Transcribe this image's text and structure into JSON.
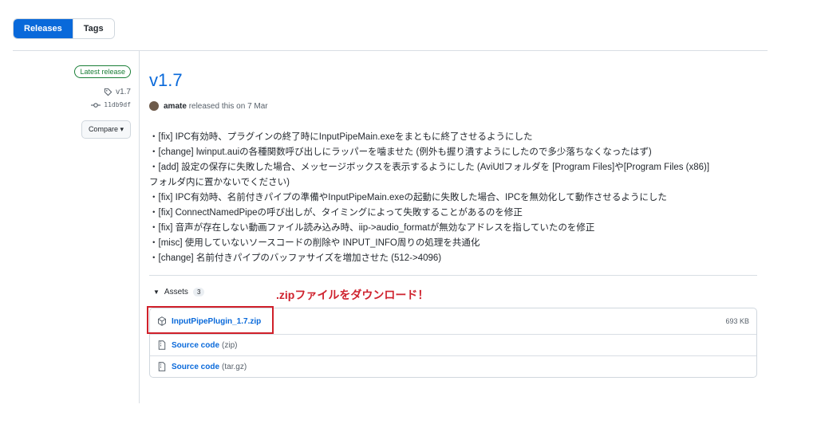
{
  "tabs": {
    "releases": "Releases",
    "tags": "Tags"
  },
  "sidebar": {
    "badge": "Latest release",
    "tag": "v1.7",
    "commit": "11db9df",
    "compare": "Compare"
  },
  "release": {
    "title": "v1.7",
    "author": "amate",
    "released_text": "released this on 7 Mar",
    "notes": [
      "・[fix] IPC有効時、プラグインの終了時にInputPipeMain.exeをまともに終了させるようにした",
      "・[change] lwinput.auiの各種関数呼び出しにラッパーを噛ませた (例外も握り潰すようにしたので多少落ちなくなったはず)",
      "・[add] 設定の保存に失敗した場合、メッセージボックスを表示するようにした (AviUtlフォルダを [Program Files]や[Program Files (x86)]",
      "フォルダ内に置かないでください)",
      "・[fix] IPC有効時、名前付きパイプの準備やInputPipeMain.exeの起動に失敗した場合、IPCを無効化して動作させるようにした",
      "・[fix] ConnectNamedPipeの呼び出しが、タイミングによって失敗することがあるのを修正",
      "・[fix] 音声が存在しない動画ファイル読み込み時、iip->audio_formatが無効なアドレスを指していたのを修正",
      "・[misc] 使用していないソースコードの削除や INPUT_INFO周りの処理を共通化",
      "・[change] 名前付きパイプのバッファサイズを増加させた (512->4096)"
    ]
  },
  "assets": {
    "label": "Assets",
    "count": "3",
    "annotation": ".zipファイルをダウンロード！",
    "items": [
      {
        "name": "InputPipePlugin_1.7.zip",
        "suffix": "",
        "size": "693 KB"
      },
      {
        "name": "Source code",
        "suffix": "(zip)",
        "size": ""
      },
      {
        "name": "Source code",
        "suffix": "(tar.gz)",
        "size": ""
      }
    ]
  },
  "colors": {
    "accent": "#0969da",
    "success": "#1a7f37",
    "highlight": "#d0202a"
  }
}
